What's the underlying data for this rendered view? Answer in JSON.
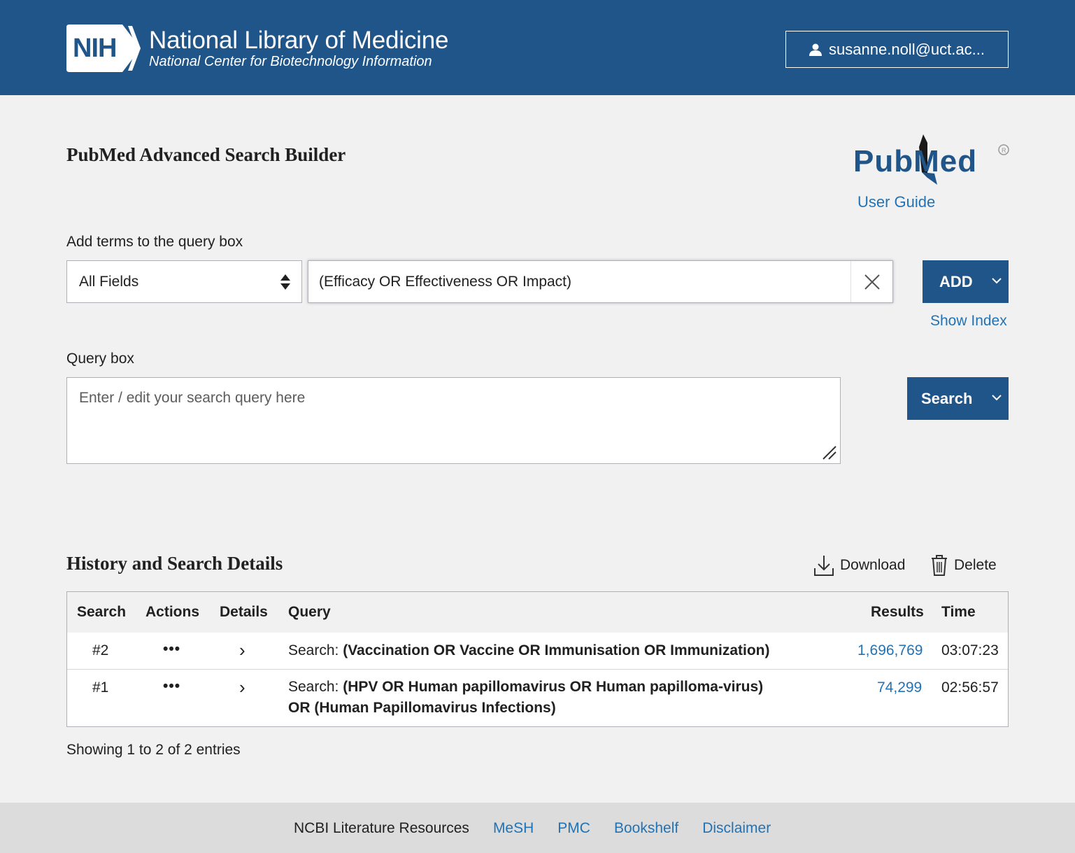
{
  "header": {
    "logo_badge": "NIH",
    "org_title": "National Library of Medicine",
    "org_subtitle": "National Center for Biotechnology Information",
    "account_label": "susanne.noll@uct.ac...",
    "bg_color": "#20558a"
  },
  "page": {
    "title": "PubMed Advanced Search Builder",
    "logo_text": "PubMed",
    "user_guide": "User Guide"
  },
  "builder": {
    "add_terms_label": "Add terms to the query box",
    "field_select_value": "All Fields",
    "term_value": "(Efficacy OR Effectiveness OR Impact)",
    "add_button": "ADD",
    "show_index": "Show Index",
    "query_box_label": "Query box",
    "query_placeholder": "Enter / edit your search query here",
    "search_button": "Search"
  },
  "history": {
    "title": "History and Search Details",
    "download": "Download",
    "delete": "Delete",
    "columns": [
      "Search",
      "Actions",
      "Details",
      "Query",
      "Results",
      "Time"
    ],
    "rows": [
      {
        "search": "#2",
        "actions": "•••",
        "details": "›",
        "query_prefix": "Search:",
        "query_line1": "(Vaccination OR Vaccine OR Immunisation OR Immunization)",
        "query_line2": "",
        "results": "1,696,769",
        "time": "03:07:23"
      },
      {
        "search": "#1",
        "actions": "•••",
        "details": "›",
        "query_prefix": "Search:",
        "query_line1": "(HPV OR Human papillomavirus OR Human papilloma-virus)",
        "query_line2": "OR (Human Papillomavirus Infections)",
        "results": "74,299",
        "time": "02:56:57"
      }
    ],
    "showing": "Showing 1 to 2 of 2 entries"
  },
  "footer": {
    "resources_label": "NCBI Literature Resources",
    "links": [
      "MeSH",
      "PMC",
      "Bookshelf",
      "Disclaimer"
    ]
  },
  "colors": {
    "primary": "#20558a",
    "link": "#2273b5",
    "page_bg": "#f1f1f1",
    "footer_bg": "#dcdcdc"
  }
}
